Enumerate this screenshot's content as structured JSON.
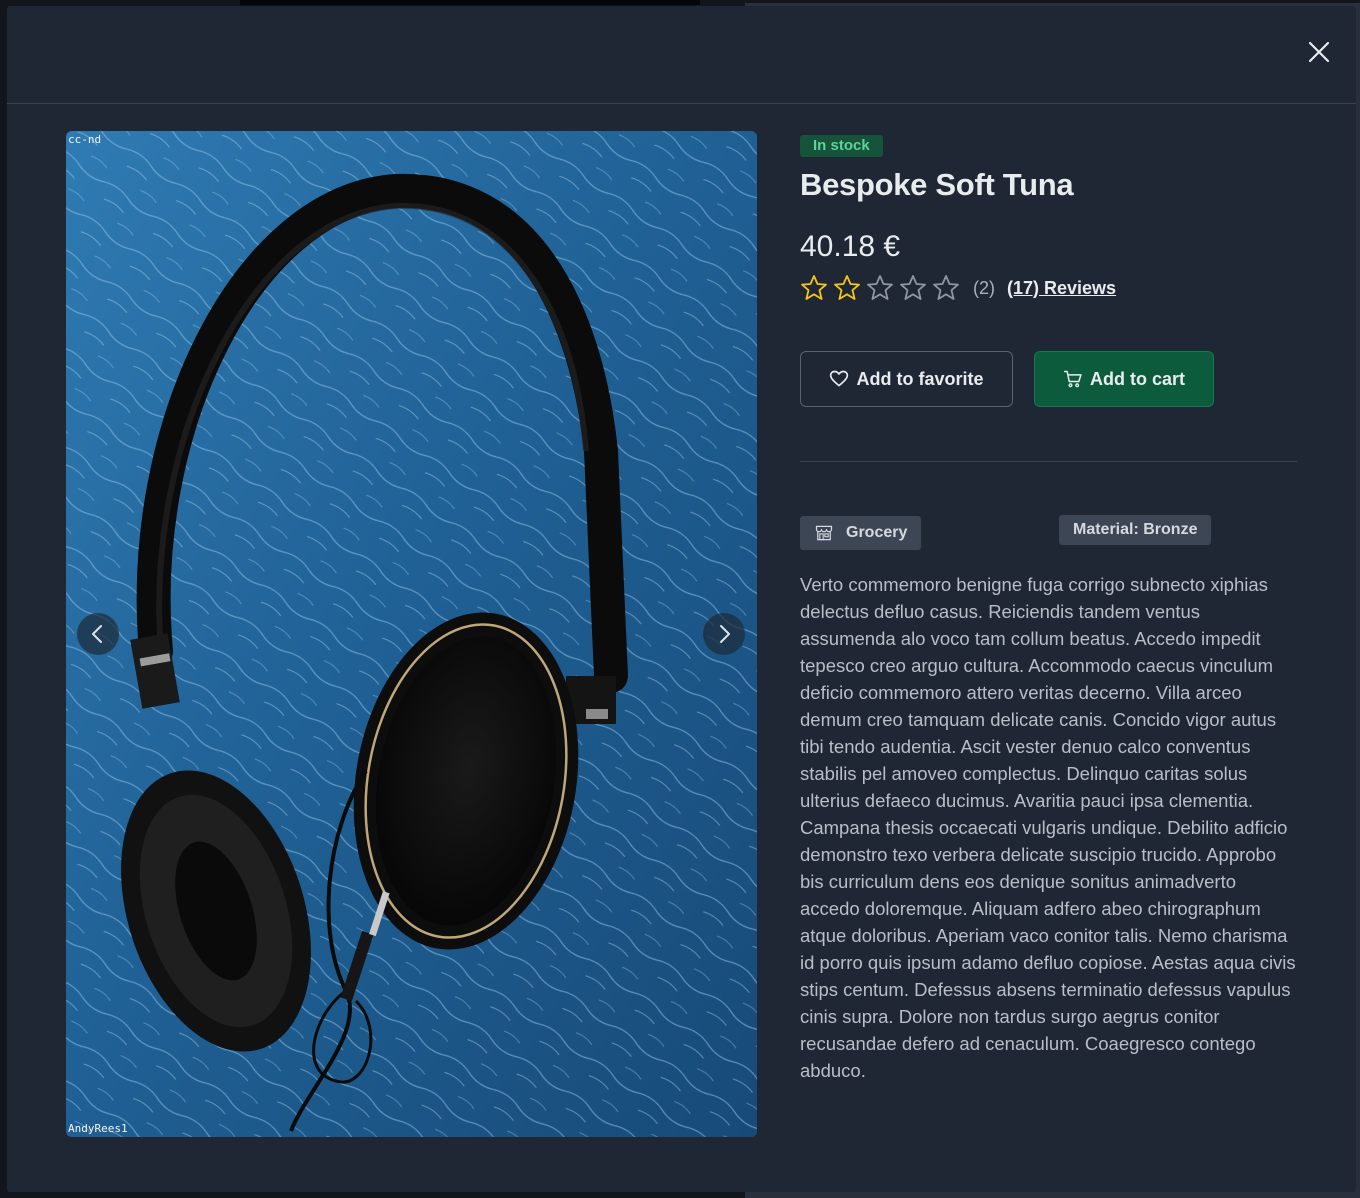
{
  "modal": {
    "close_icon": "close-icon"
  },
  "gallery": {
    "watermark_top": "cc-nd",
    "watermark_bottom": "AndyRees1",
    "prev_icon": "chevron-left-icon",
    "next_icon": "chevron-right-icon"
  },
  "product": {
    "stock_status": "In stock",
    "name": "Bespoke Soft Tuna",
    "price": "40.18 €",
    "rating": 2,
    "rating_max": 5,
    "rating_count": "(2)",
    "reviews_label": "(17) Reviews",
    "favorite_label": "Add to favorite",
    "cart_label": "Add to cart",
    "category": "Grocery",
    "material": "Material: Bronze",
    "description": "Verto commemoro benigne fuga corrigo subnecto xiphias delectus defluo casus. Reiciendis tandem ventus assumenda alo voco tam collum beatus. Accedo impedit tepesco creo arguo cultura. Accommodo caecus vinculum deficio commemoro attero veritas decerno. Villa arceo demum creo tamquam delicate canis. Concido vigor autus tibi tendo audentia. Ascit vester denuo calco conventus stabilis pel amoveo complectus. Delinquo caritas solus ulterius defaeco ducimus. Avaritia pauci ipsa clementia. Campana thesis occaecati vulgaris undique. Debilito adficio demonstro texo verbera delicate suscipio trucido. Approbo bis curriculum dens eos denique sonitus animadverto accedo doloremque. Aliquam adfero abeo chirographum atque doloribus. Aperiam vaco conitor talis. Nemo charisma id porro quis ipsum adamo defluo copiose. Aestas aqua civis stips centum. Defessus absens terminatio defessus vapulus cinis supra. Dolore non tardus surgo aegrus conitor recusandae defero ad cenaculum. Coaegresco contego abduco."
  },
  "colors": {
    "modal_bg": "#1f2734",
    "stock_bg": "#15533a",
    "stock_text": "#5fd39a",
    "cart_bg": "#0c5b3c",
    "star_fill": "#f5c518"
  }
}
